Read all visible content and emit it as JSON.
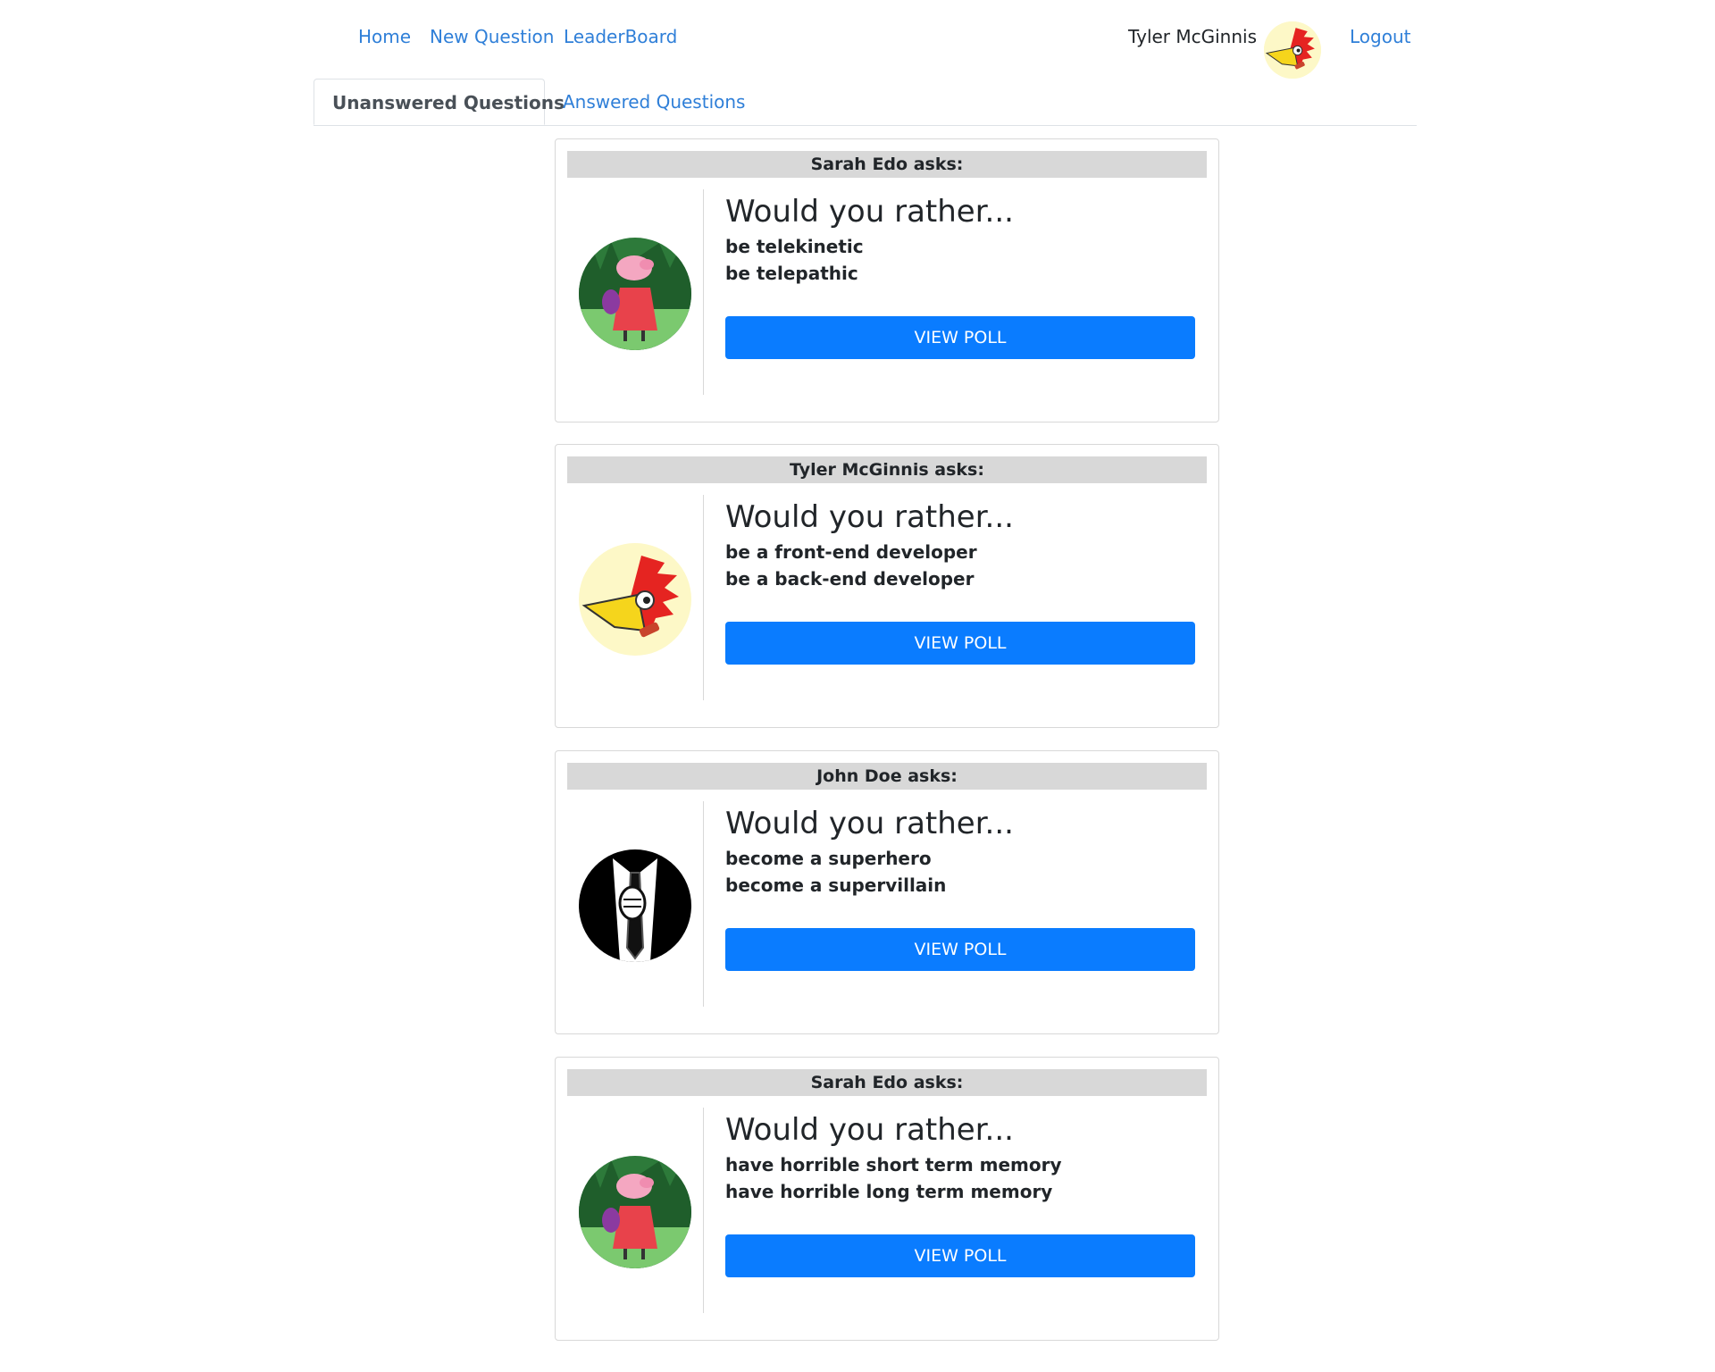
{
  "nav": {
    "home": "Home",
    "new_question": "New Question",
    "leaderboard": "LeaderBoard",
    "user_name": "Tyler McGinnis",
    "logout": "Logout",
    "avatar_icon": "woodpecker-avatar-icon"
  },
  "tabs": {
    "unanswered": "Unanswered Questions",
    "answered": "Answered Questions",
    "active": "unanswered"
  },
  "colors": {
    "link": "#2f7fd8",
    "button": "#0a7cff",
    "header_bg": "#d8d8d8"
  },
  "questions": [
    {
      "asker": "Sarah Edo asks:",
      "avatar": "pig-avatar-icon",
      "title": "Would you rather...",
      "option_one": "be telekinetic",
      "option_two": "be telepathic",
      "button": "VIEW POLL"
    },
    {
      "asker": "Tyler McGinnis asks:",
      "avatar": "woodpecker-avatar-icon",
      "title": "Would you rather...",
      "option_one": "be a front-end developer",
      "option_two": "be a back-end developer",
      "button": "VIEW POLL"
    },
    {
      "asker": "John Doe asks:",
      "avatar": "suit-avatar-icon",
      "title": "Would you rather...",
      "option_one": "become a superhero",
      "option_two": "become a supervillain",
      "button": "VIEW POLL"
    },
    {
      "asker": "Sarah Edo asks:",
      "avatar": "pig-avatar-icon",
      "title": "Would you rather...",
      "option_one": "have horrible short term memory",
      "option_two": "have horrible long term memory",
      "button": "VIEW POLL"
    }
  ]
}
